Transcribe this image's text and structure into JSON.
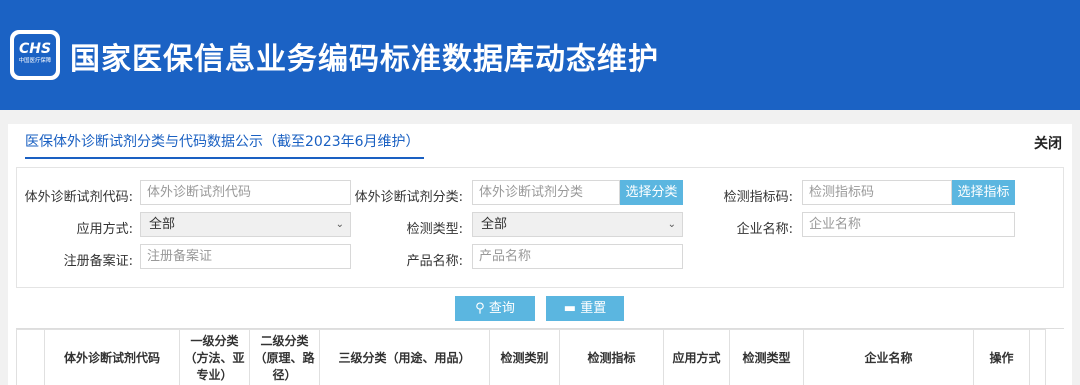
{
  "header": {
    "logo_text": "CHS",
    "logo_subtext": "中国医疗保障",
    "title": "国家医保信息业务编码标准数据库动态维护"
  },
  "tab": {
    "label": "医保体外诊断试剂分类与代码数据公示（截至2023年6月维护）",
    "close_label": "关闭"
  },
  "filters": {
    "code_label": "体外诊断试剂代码:",
    "code_placeholder": "体外诊断试剂代码",
    "category_label": "体外诊断试剂分类:",
    "category_placeholder": "体外诊断试剂分类",
    "category_btn": "选择分类",
    "indicator_label": "检测指标码:",
    "indicator_placeholder": "检测指标码",
    "indicator_btn": "选择指标",
    "apply_label": "应用方式:",
    "apply_value": "全部",
    "detect_type_label": "检测类型:",
    "detect_type_value": "全部",
    "company_label": "企业名称:",
    "company_placeholder": "企业名称",
    "reg_label": "注册备案证:",
    "reg_placeholder": "注册备案证",
    "product_label": "产品名称:",
    "product_placeholder": "产品名称"
  },
  "actions": {
    "search_label": "查询",
    "reset_label": "重置"
  },
  "table": {
    "columns": [
      "",
      "体外诊断试剂代码",
      "一级分类（方法、亚专业）",
      "二级分类（原理、路径）",
      "三级分类（用途、用品）",
      "检测类别",
      "检测指标",
      "应用方式",
      "检测类型",
      "企业名称",
      "操作",
      ""
    ]
  }
}
